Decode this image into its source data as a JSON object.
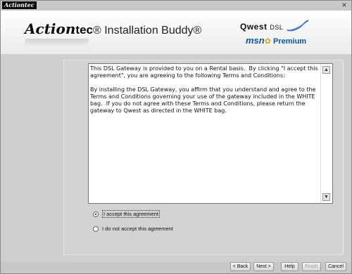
{
  "titlebar": {
    "logo_text": "Actiontec",
    "close_label": "×"
  },
  "header": {
    "brand_action": "Action",
    "brand_tec": "tec",
    "brand_rest": "® Installation Buddy®",
    "qwest": "Qwest",
    "dsl": "DSL",
    "msn": "msn",
    "premium": "Premium"
  },
  "agreement": {
    "paragraph1": "This DSL Gateway is provided to you on a Rental basis.  By clicking \"I accept this agreement\", you are agreeing to the following Terms and Conditions:",
    "paragraph2": "By installing the DSL Gateway, you affirm that you understand and agree to the Terms and Conditions governing your use of the gateway included in the WHITE bag.  If you do not agree with these Terms and Conditions, please return the gateway to Qwest as directed in the WHITE bag."
  },
  "options": [
    {
      "label": "I accept this agreement",
      "checked": true
    },
    {
      "label": "I do not accept this agreement",
      "checked": false
    }
  ],
  "buttons": {
    "back": "< Back",
    "next": "Next >",
    "help": "Help",
    "finish": "Finish",
    "cancel": "Cancel"
  }
}
